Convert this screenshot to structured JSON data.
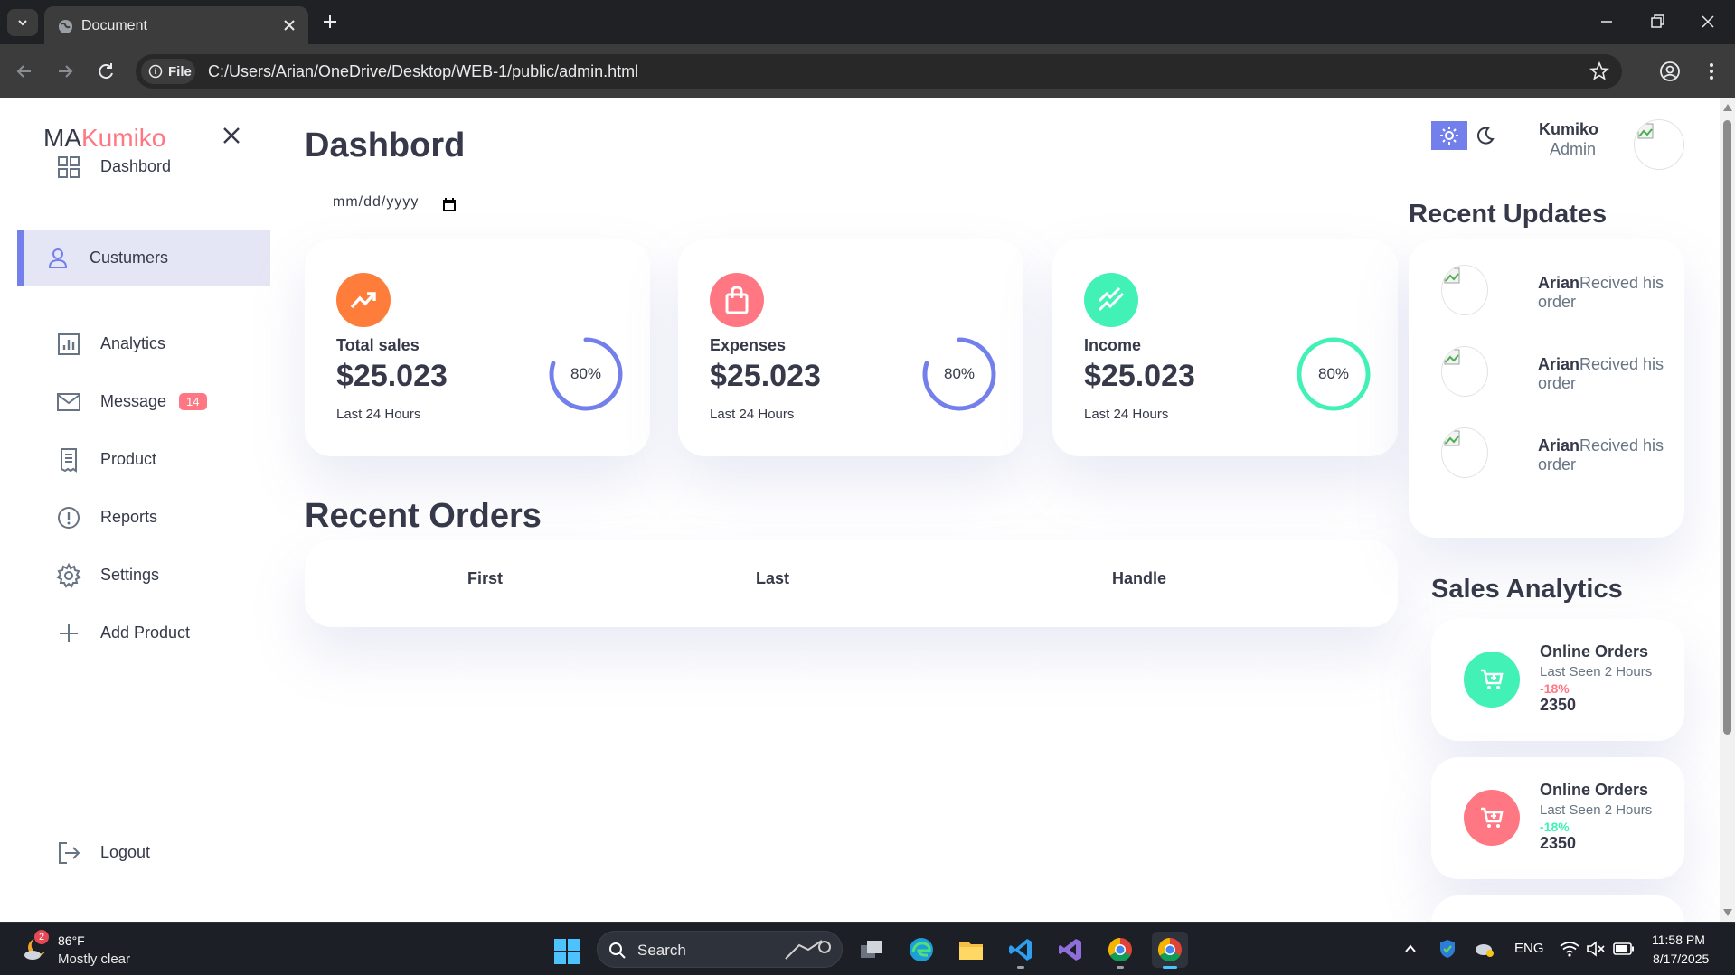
{
  "browser": {
    "tab_title": "Document",
    "url_chip": "File",
    "url": "C:/Users/Arian/OneDrive/Desktop/WEB-1/public/admin.html"
  },
  "colors": {
    "primary": "#7380ec",
    "danger": "#ff7782",
    "success": "#41f1b6",
    "warning": "#ff7d3b",
    "dark_text": "#363949",
    "muted_text": "#677483"
  },
  "sidebar": {
    "logo_prefix": "MA",
    "logo_accent": "Kumiko",
    "items": [
      {
        "label": "Dashbord",
        "icon": "grid-icon"
      },
      {
        "label": "Custumers",
        "icon": "person-icon",
        "active": true
      },
      {
        "label": "Analytics",
        "icon": "analytics-icon"
      },
      {
        "label": "Message",
        "icon": "mail-icon",
        "badge": "14"
      },
      {
        "label": "Product",
        "icon": "receipt-icon"
      },
      {
        "label": "Reports",
        "icon": "report-icon"
      },
      {
        "label": "Settings",
        "icon": "gear-icon"
      },
      {
        "label": "Add Product",
        "icon": "plus-icon"
      }
    ],
    "logout_label": "Logout"
  },
  "main": {
    "title": "Dashbord",
    "date_placeholder": "mm/dd/yyyy",
    "cards": [
      {
        "label": "Total sales",
        "value": "$25.023",
        "sub": "Last 24 Hours",
        "percent": "80%",
        "icon": "trending-up-icon",
        "progress": 0.8
      },
      {
        "label": "Expenses",
        "value": "$25.023",
        "sub": "Last 24 Hours",
        "percent": "80%",
        "icon": "shopping-bag-icon",
        "progress": 0.8
      },
      {
        "label": "Income",
        "value": "$25.023",
        "sub": "Last 24 Hours",
        "percent": "80%",
        "icon": "stacked-line-icon",
        "progress": 1.0
      }
    ],
    "orders_title": "Recent Orders",
    "orders_columns": [
      "First",
      "Last",
      "Handle"
    ]
  },
  "right": {
    "user_name": "Kumiko",
    "user_role": "Admin",
    "updates_title": "Recent Updates",
    "updates": [
      {
        "name": "Arian",
        "text": "Recived his order"
      },
      {
        "name": "Arian",
        "text": "Recived his order"
      },
      {
        "name": "Arian",
        "text": "Recived his order"
      }
    ],
    "sales_title": "Sales Analytics",
    "sales": [
      {
        "title": "Online Orders",
        "sub": "Last Seen 2 Hours",
        "pct": "-18%",
        "num": "2350"
      },
      {
        "title": "Online Orders",
        "sub": "Last Seen 2 Hours",
        "pct": "-18%",
        "num": "2350"
      }
    ]
  },
  "taskbar": {
    "weather_badge": "2",
    "weather_temp": "86°F",
    "weather_desc": "Mostly clear",
    "search_label": "Search",
    "lang": "ENG",
    "time": "11:58 PM",
    "date": "8/17/2025"
  }
}
